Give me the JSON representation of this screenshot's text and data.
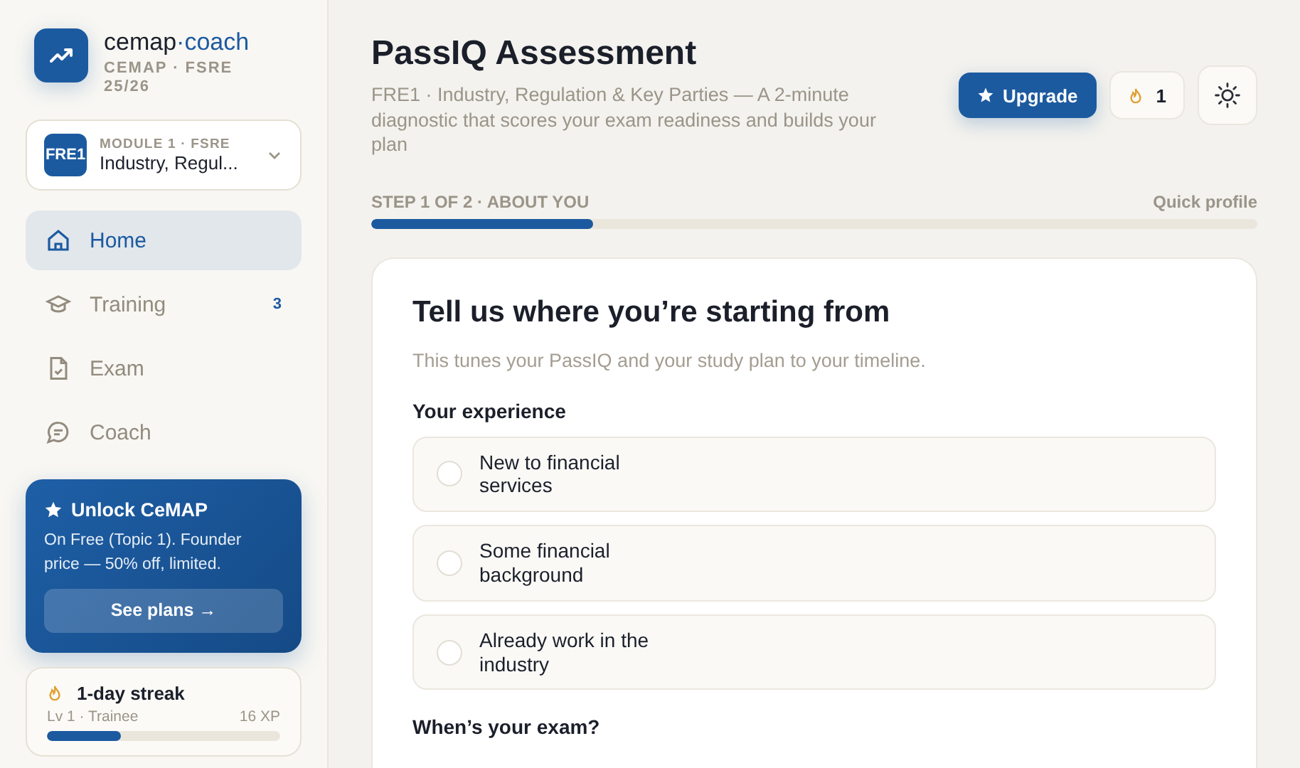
{
  "brand": {
    "name_main": "cemap",
    "name_accent": "·coach",
    "subtitle": "CEMAP · FSRE 25/26"
  },
  "module": {
    "badge": "FRE1",
    "eyebrow": "MODULE 1 · FSRE",
    "title": "Industry, Regul..."
  },
  "nav": [
    {
      "kind": "home",
      "label": "Home",
      "selected": true
    },
    {
      "kind": "training",
      "label": "Training",
      "selected": false,
      "count": "3"
    },
    {
      "kind": "exam",
      "label": "Exam",
      "selected": false
    },
    {
      "kind": "coach",
      "label": "Coach",
      "selected": false
    }
  ],
  "promo": {
    "title": "Unlock CeMAP",
    "text": "On Free (Topic 1). Founder price — 50% off, limited.",
    "button": "See plans →"
  },
  "streak": {
    "title": "1-day streak",
    "level_label": "Lv 1 · Trainee",
    "xp": "16 XP",
    "level": 0.32
  },
  "header": {
    "title": "PassIQ Assessment",
    "subtitle": "FRE1 · Industry, Regulation & Key Parties — A 2-minute diagnostic that scores your exam readiness and builds your plan",
    "upgrade": "Upgrade",
    "streak_count": "1"
  },
  "progress": {
    "step": "STEP 1 OF 2 · ABOUT YOU",
    "right": "Quick profile",
    "level": 0.25
  },
  "card": {
    "title": "Tell us where you’re starting from",
    "subtitle": "This tunes your PassIQ and your study plan to your timeline.",
    "sections": [
      {
        "label": "Your experience",
        "options": [
          {
            "label": "New to financial services",
            "selected": false
          },
          {
            "label": "Some financial background",
            "selected": false
          },
          {
            "label": "Already work in the industry",
            "selected": false
          }
        ]
      },
      {
        "label": "When’s your exam?"
      }
    ]
  }
}
